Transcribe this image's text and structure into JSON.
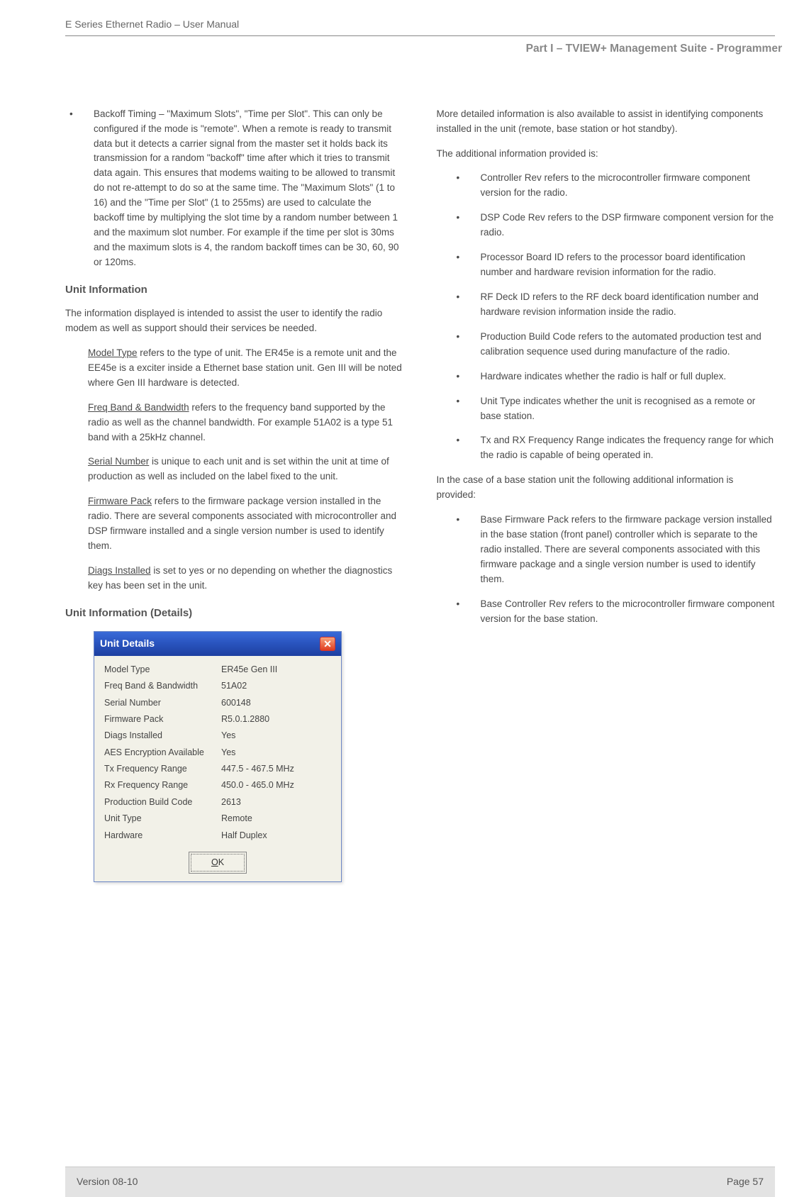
{
  "header": {
    "doc_title": "E Series Ethernet Radio – User Manual",
    "part_title": "Part I – TVIEW+ Management Suite - Programmer"
  },
  "left": {
    "backoff_bullet": "Backoff Timing – \"Maximum Slots\", \"Time per Slot\". This can only be configured if the mode is \"remote\". When a remote is ready to transmit data but it detects a carrier signal from the master set it holds back its transmission for a random \"backoff\" time after which it tries to transmit data again. This ensures that modems waiting to be allowed to transmit do not re-attempt to do so at the same time. The \"Maximum Slots\" (1 to 16) and the \"Time per Slot\" (1 to 255ms) are used to calculate the backoff time by multiplying the slot time by a random number between 1 and the maximum slot number. For example if the time per slot is 30ms and the maximum slots is 4, the random backoff times can be 30, 60, 90 or 120ms.",
    "h_unit_info": "Unit Information",
    "unit_info_intro": "The information displayed is intended to assist the user to identify the radio modem as well as support should their services be needed.",
    "defs": {
      "model_type_label": "Model Type",
      "model_type_text": " refers to the type of unit. The ER45e is a remote unit and the EE45e is a exciter inside a Ethernet base station unit. Gen III will be noted where Gen III hardware is detected.",
      "freq_label": "Freq Band & Bandwidth",
      "freq_text": " refers to the frequency band supported by the radio as well as the channel bandwidth. For example 51A02 is a type 51 band with a 25kHz channel.",
      "serial_label": "Serial Number",
      "serial_text": " is unique to each unit and is set within the unit at time of production as well as included on the label fixed to the unit.",
      "fw_label": "Firmware Pack",
      "fw_text": " refers to the firmware package version installed in the radio. There are several components associated with microcontroller and DSP firmware installed and a single version number is used to identify them.",
      "diags_label": "Diags Installed",
      "diags_text": " is set to yes or no depending on whether the diagnostics key has been set in the unit."
    },
    "h_unit_info_details": "Unit Information (Details)"
  },
  "right": {
    "intro": "More detailed information is also available to assist in identifying components installed in the unit (remote, base station or hot standby).",
    "add_info": "The additional information provided is:",
    "bullets": [
      "Controller Rev refers to the microcontroller firmware component version for the radio.",
      "DSP Code Rev refers to the DSP firmware component version for the radio.",
      "Processor Board ID refers to the processor board identification number and hardware revision information for the radio.",
      "RF Deck ID refers to the RF deck board identification number and hardware revision information inside the radio.",
      "Production Build Code refers to the automated production test and calibration sequence used during manufacture of the radio.",
      "Hardware indicates whether the radio is half or full duplex.",
      "Unit Type indicates whether the unit is recognised as a remote or base station.",
      "Tx and RX  Frequency Range indicates the frequency range for which the radio is capable of being operated in."
    ],
    "base_intro": "In the case of a base station unit the following additional information is provided:",
    "base_bullets": [
      "Base Firmware Pack refers to the firmware package version installed in the base station (front panel) controller which is separate to the radio installed. There are several components associated with this firmware package and a single version number is used to identify them.",
      "Base Controller Rev refers to the microcontroller firmware component version for the base station."
    ]
  },
  "dialog": {
    "title": "Unit Details",
    "close_glyph": "✕",
    "rows": [
      {
        "label": "Model Type",
        "value": "ER45e Gen III"
      },
      {
        "label": "Freq Band & Bandwidth",
        "value": "51A02"
      },
      {
        "label": "Serial Number",
        "value": "600148"
      },
      {
        "label": "Firmware Pack",
        "value": "R5.0.1.2880"
      },
      {
        "label": "Diags Installed",
        "value": "Yes"
      },
      {
        "label": "AES Encryption Available",
        "value": "Yes"
      },
      {
        "label": "Tx Frequency Range",
        "value": "447.5 - 467.5 MHz"
      },
      {
        "label": "Rx Frequency Range",
        "value": "450.0 - 465.0 MHz"
      },
      {
        "label": "Production Build Code",
        "value": "2613"
      },
      {
        "label": "Unit Type",
        "value": "Remote"
      },
      {
        "label": "Hardware",
        "value": "Half Duplex"
      }
    ],
    "ok_prefix": "O",
    "ok_rest": "K"
  },
  "footer": {
    "version": "Version 08-10",
    "page": "Page 57"
  }
}
